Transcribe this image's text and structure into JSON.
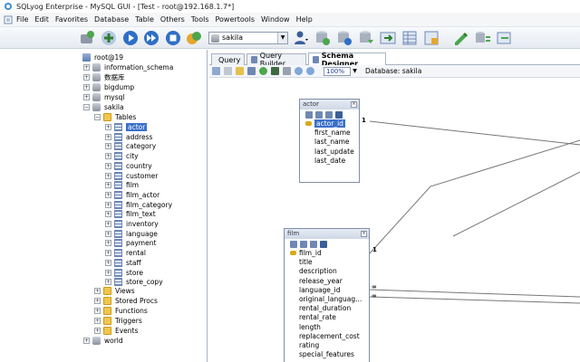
{
  "window": {
    "title": "SQLyog Enterprise - MySQL GUI - [Test - root@192.168.1.7*]"
  },
  "menu": [
    "File",
    "Edit",
    "Favorites",
    "Database",
    "Table",
    "Others",
    "Tools",
    "Powertools",
    "Window",
    "Help"
  ],
  "toolbar": {
    "database_select": "sakila"
  },
  "tree": {
    "root": "root@19",
    "databases": [
      "information_schema",
      "数据库",
      "bigdump",
      "mysql",
      "sakila"
    ],
    "sakila_folders": {
      "tables": "Tables"
    },
    "tables": [
      "actor",
      "address",
      "category",
      "city",
      "country",
      "customer",
      "film",
      "film_actor",
      "film_category",
      "film_text",
      "inventory",
      "language",
      "payment",
      "rental",
      "staff",
      "store",
      "store_copy"
    ],
    "other_folders": [
      "Views",
      "Stored Procs",
      "Functions",
      "Triggers",
      "Events"
    ],
    "last_db": "world"
  },
  "tabs": [
    "Query",
    "Query Builder",
    "Schema Designer"
  ],
  "designer": {
    "zoom": "100%",
    "database_label": "Database: sakila"
  },
  "schema": {
    "actor": {
      "name": "actor",
      "columns": [
        "actor_id",
        "first_name",
        "last_name",
        "last_update",
        "last_date"
      ]
    },
    "film": {
      "name": "film",
      "columns": [
        "film_id",
        "title",
        "description",
        "release_year",
        "language_id",
        "original_languag...",
        "rental_duration",
        "rental_rate",
        "length",
        "replacement_cost",
        "rating",
        "special_features"
      ]
    },
    "relation_labels": {
      "one_a": "1",
      "one_b": "1",
      "many_a": "∞",
      "many_b": "∞"
    }
  },
  "colors": {
    "selection": "#3a6fc9",
    "accent": "#6f88b3"
  }
}
